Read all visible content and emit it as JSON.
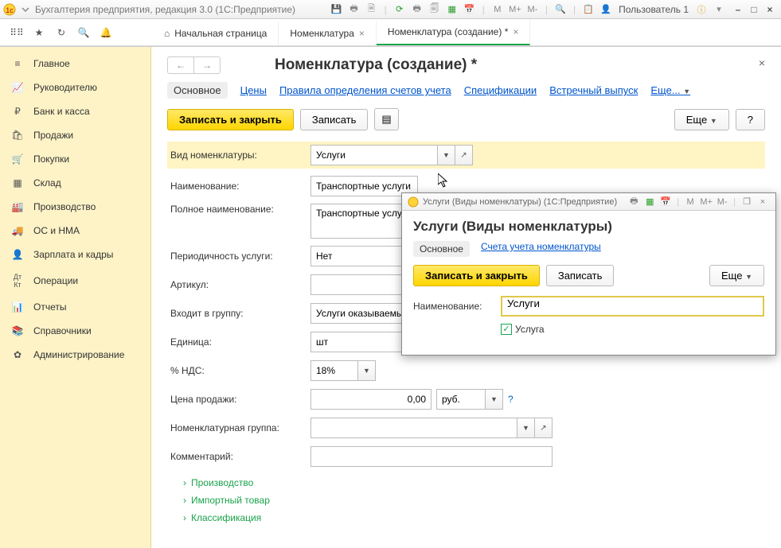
{
  "titlebar": {
    "app_title": "Бухгалтерия предприятия, редакция 3.0  (1С:Предприятие)",
    "user": "Пользователь 1",
    "m": "M",
    "mplus": "M+",
    "mminus": "M-"
  },
  "tabs": {
    "home": "Начальная страница",
    "t1": "Номенклатура",
    "t2": "Номенклатура (создание) *"
  },
  "sidebar": {
    "items": [
      {
        "label": "Главное"
      },
      {
        "label": "Руководителю"
      },
      {
        "label": "Банк и касса"
      },
      {
        "label": "Продажи"
      },
      {
        "label": "Покупки"
      },
      {
        "label": "Склад"
      },
      {
        "label": "Производство"
      },
      {
        "label": "ОС и НМА"
      },
      {
        "label": "Зарплата и кадры"
      },
      {
        "label": "Операции"
      },
      {
        "label": "Отчеты"
      },
      {
        "label": "Справочники"
      },
      {
        "label": "Администрирование"
      }
    ]
  },
  "page": {
    "title": "Номенклатура (создание) *",
    "subnav": {
      "main": "Основное",
      "prices": "Цены",
      "rules": "Правила определения счетов учета",
      "specs": "Спецификации",
      "vstrech": "Встречный выпуск",
      "more": "Еще..."
    },
    "actions": {
      "save_close": "Записать и закрыть",
      "save": "Записать",
      "more": "Еще",
      "help": "?"
    },
    "fields": {
      "kind_label": "Вид номенклатуры:",
      "kind_value": "Услуги",
      "name_label": "Наименование:",
      "name_value": "Транспортные услуги",
      "fullname_label": "Полное наименование:",
      "fullname_value": "Транспортные услуги",
      "period_label": "Периодичность услуги:",
      "period_value": "Нет",
      "article_label": "Артикул:",
      "article_value": "",
      "group_label": "Входит в группу:",
      "group_value": "Услуги оказываемые",
      "unit_label": "Единица:",
      "unit_value": "шт",
      "vat_label": "% НДС:",
      "vat_value": "18%",
      "price_label": "Цена продажи:",
      "price_value": "0,00",
      "price_currency": "руб.",
      "nomgroup_label": "Номенклатурная группа:",
      "nomgroup_value": "",
      "comment_label": "Комментарий:",
      "comment_value": ""
    },
    "tree": {
      "item1": "Производство",
      "item2": "Импортный товар",
      "item3": "Классификация"
    }
  },
  "dialog": {
    "title": "Услуги (Виды номенклатуры)  (1С:Предприятие)",
    "heading": "Услуги (Виды номенклатуры)",
    "subnav_main": "Основное",
    "subnav_accounts": "Счета учета номенклатуры",
    "save_close": "Записать и закрыть",
    "save": "Записать",
    "more": "Еще",
    "name_label": "Наименование:",
    "name_value": "Услуги",
    "service_label": "Услуга",
    "m": "M",
    "mplus": "M+",
    "mminus": "M-"
  }
}
